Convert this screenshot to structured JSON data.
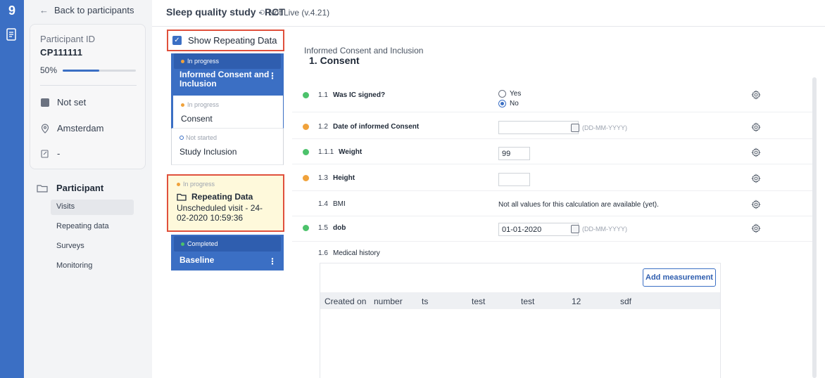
{
  "rail": {
    "logo": "9"
  },
  "sidebar": {
    "back_label": "Back to participants",
    "participant_id_label": "Participant ID",
    "participant_id": "CP111111",
    "progress_text": "50%",
    "progress_fraction": 0.5,
    "status": "Not set",
    "site": "Amsterdam",
    "note": "-",
    "nav_title": "Participant",
    "nav_items": [
      "Visits",
      "Repeating data",
      "Surveys",
      "Monitoring"
    ]
  },
  "header": {
    "study_title": "Sleep quality study - RCT",
    "status": "Not Live (v.4.21)"
  },
  "show_repeating": {
    "label": "Show Repeating Data",
    "checked": true
  },
  "steps": {
    "group1_badge": "In progress",
    "group1_title": "Informed Consent and Inclusion",
    "consent_status": "In progress",
    "consent_name": "Consent",
    "inclusion_status": "Not started",
    "inclusion_name": "Study Inclusion",
    "repeating_status": "In progress",
    "repeating_title": "Repeating Data",
    "repeating_sub": "Unscheduled visit - 24-02-2020 10:59:36",
    "baseline_badge": "Completed",
    "baseline_title": "Baseline"
  },
  "form": {
    "section": "Informed Consent and Inclusion",
    "title": "1. Consent",
    "fields": [
      {
        "num": "1.1",
        "label": "Was IC signed?",
        "yes": "Yes",
        "no": "No"
      },
      {
        "num": "1.2",
        "label": "Date of informed Consent",
        "value": "",
        "hint": "(DD-MM-YYYY)"
      },
      {
        "num": "1.1.1",
        "label": "Weight",
        "value": "99"
      },
      {
        "num": "1.3",
        "label": "Height",
        "value": ""
      },
      {
        "num": "1.4",
        "label": "BMI",
        "value": "Not all values for this calculation are available (yet)."
      },
      {
        "num": "1.5",
        "label": "dob",
        "value": "01-01-2020",
        "hint": "(DD-MM-YYYY)"
      },
      {
        "num": "1.6",
        "label": "Medical history"
      }
    ],
    "add_measurement": "Add measurement",
    "table_columns": [
      "Created on",
      "number",
      "ts",
      "test",
      "test",
      "12",
      "sdf"
    ]
  },
  "colors": {
    "brand": "#3b6fc4",
    "highlight_border": "#e0503c",
    "green": "#4cc26b",
    "orange": "#f0a23b"
  }
}
